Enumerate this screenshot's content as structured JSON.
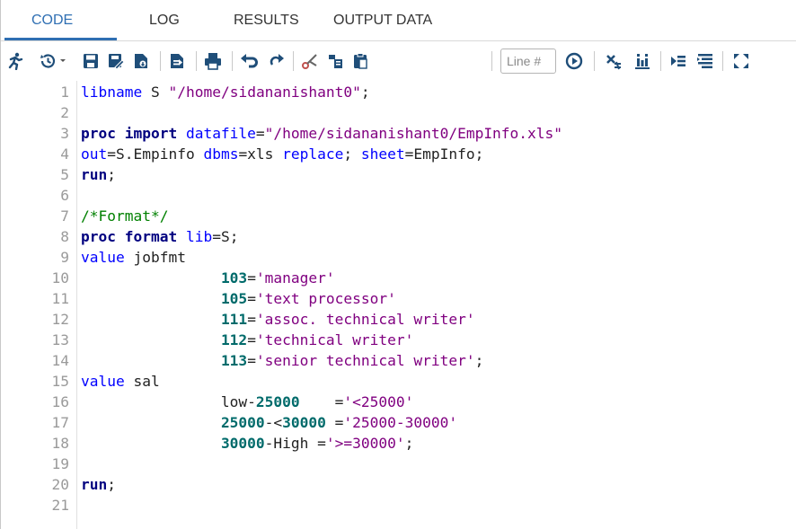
{
  "tabs": [
    {
      "label": "CODE",
      "active": true
    },
    {
      "label": "LOG",
      "active": false
    },
    {
      "label": "RESULTS",
      "active": false
    },
    {
      "label": "OUTPUT DATA",
      "active": false
    }
  ],
  "toolbar": {
    "line_placeholder": "Line #",
    "icons": [
      "run-icon",
      "history-icon",
      "save-icon",
      "save-as-icon",
      "download-icon",
      "export-icon",
      "print-icon",
      "undo-icon",
      "redo-icon",
      "cut-icon",
      "copy-icon",
      "paste-icon",
      "go-icon",
      "clear-icon",
      "format-code-icon",
      "snippet-icon",
      "collapse-icon",
      "maximize-icon"
    ]
  },
  "colors": {
    "accent": "#2f6fb3",
    "keyword": "#0000ff",
    "keyword_bold": "#000080",
    "string": "#800080",
    "number": "#006b6b",
    "comment": "#008000"
  },
  "code": {
    "lines": [
      {
        "n": "1",
        "tokens": [
          [
            "kw",
            "libname"
          ],
          [
            "plain",
            " S "
          ],
          [
            "str",
            "\"/home/sidananishant0\""
          ],
          [
            "plain",
            ";"
          ]
        ]
      },
      {
        "n": "2",
        "tokens": []
      },
      {
        "n": "3",
        "tokens": [
          [
            "kwb",
            "proc import"
          ],
          [
            "plain",
            " "
          ],
          [
            "kw",
            "datafile"
          ],
          [
            "plain",
            "="
          ],
          [
            "str",
            "\"/home/sidananishant0/EmpInfo.xls\""
          ]
        ]
      },
      {
        "n": "4",
        "tokens": [
          [
            "kw",
            "out"
          ],
          [
            "plain",
            "=S.Empinfo "
          ],
          [
            "kw",
            "dbms"
          ],
          [
            "plain",
            "=xls "
          ],
          [
            "kw",
            "replace"
          ],
          [
            "plain",
            "; "
          ],
          [
            "kw",
            "sheet"
          ],
          [
            "plain",
            "=EmpInfo;"
          ]
        ]
      },
      {
        "n": "5",
        "tokens": [
          [
            "kwb",
            "run"
          ],
          [
            "plain",
            ";"
          ]
        ]
      },
      {
        "n": "6",
        "tokens": []
      },
      {
        "n": "7",
        "tokens": [
          [
            "com",
            "/*Format*/"
          ]
        ]
      },
      {
        "n": "8",
        "tokens": [
          [
            "kwb",
            "proc format"
          ],
          [
            "plain",
            " "
          ],
          [
            "kw",
            "lib"
          ],
          [
            "plain",
            "=S;"
          ]
        ]
      },
      {
        "n": "9",
        "tokens": [
          [
            "kw",
            "value"
          ],
          [
            "plain",
            " jobfmt"
          ]
        ]
      },
      {
        "n": "10",
        "tokens": [
          [
            "plain",
            "                "
          ],
          [
            "num",
            "103"
          ],
          [
            "plain",
            "="
          ],
          [
            "str",
            "'manager'"
          ]
        ]
      },
      {
        "n": "11",
        "tokens": [
          [
            "plain",
            "                "
          ],
          [
            "num",
            "105"
          ],
          [
            "plain",
            "="
          ],
          [
            "str",
            "'text processor'"
          ]
        ]
      },
      {
        "n": "12",
        "tokens": [
          [
            "plain",
            "                "
          ],
          [
            "num",
            "111"
          ],
          [
            "plain",
            "="
          ],
          [
            "str",
            "'assoc. technical writer'"
          ]
        ]
      },
      {
        "n": "13",
        "tokens": [
          [
            "plain",
            "                "
          ],
          [
            "num",
            "112"
          ],
          [
            "plain",
            "="
          ],
          [
            "str",
            "'technical writer'"
          ]
        ]
      },
      {
        "n": "14",
        "tokens": [
          [
            "plain",
            "                "
          ],
          [
            "num",
            "113"
          ],
          [
            "plain",
            "="
          ],
          [
            "str",
            "'senior technical writer'"
          ],
          [
            "plain",
            ";"
          ]
        ]
      },
      {
        "n": "15",
        "tokens": [
          [
            "kw",
            "value"
          ],
          [
            "plain",
            " sal"
          ]
        ]
      },
      {
        "n": "16",
        "tokens": [
          [
            "plain",
            "                low-"
          ],
          [
            "num",
            "25000"
          ],
          [
            "plain",
            "    ="
          ],
          [
            "str",
            "'<25000'"
          ]
        ]
      },
      {
        "n": "17",
        "tokens": [
          [
            "plain",
            "                "
          ],
          [
            "num",
            "25000"
          ],
          [
            "plain",
            "-<"
          ],
          [
            "num",
            "30000"
          ],
          [
            "plain",
            " ="
          ],
          [
            "str",
            "'25000-30000'"
          ]
        ]
      },
      {
        "n": "18",
        "tokens": [
          [
            "plain",
            "                "
          ],
          [
            "num",
            "30000"
          ],
          [
            "plain",
            "-High ="
          ],
          [
            "str",
            "'>=30000'"
          ],
          [
            "plain",
            ";"
          ]
        ]
      },
      {
        "n": "19",
        "tokens": []
      },
      {
        "n": "20",
        "tokens": [
          [
            "kwb",
            "run"
          ],
          [
            "plain",
            ";"
          ]
        ]
      },
      {
        "n": "21",
        "tokens": []
      }
    ]
  }
}
